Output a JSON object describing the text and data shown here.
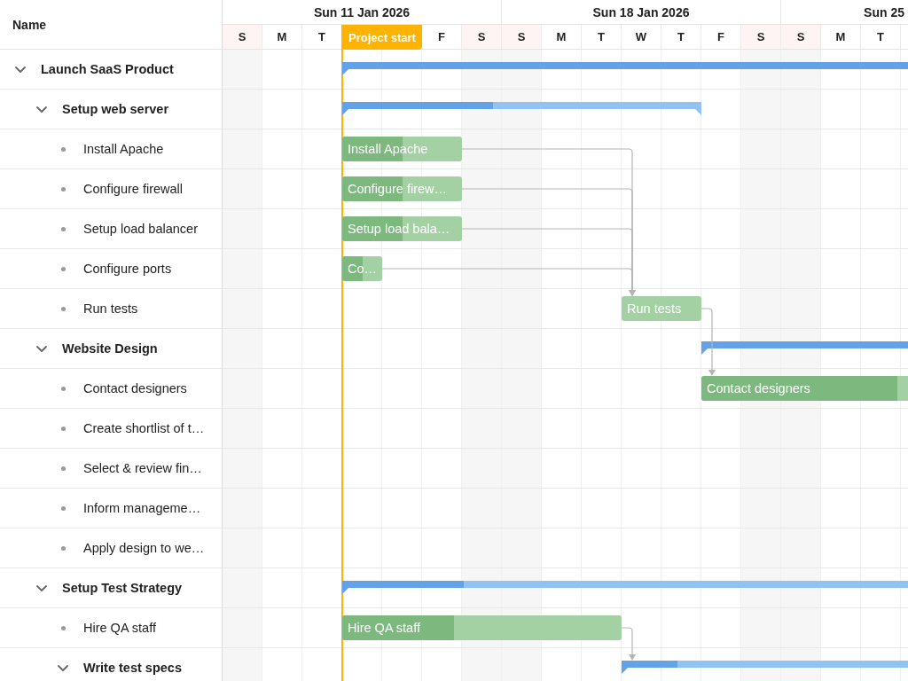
{
  "header": {
    "name_column": "Name"
  },
  "timeline": {
    "weeks": [
      "Sun 11 Jan 2026",
      "Sun 18 Jan 2026",
      "Sun 25"
    ],
    "days": [
      {
        "kind": "day",
        "letter": "S",
        "weekend": true
      },
      {
        "kind": "day",
        "letter": "M",
        "weekend": false
      },
      {
        "kind": "day",
        "letter": "T",
        "weekend": false
      },
      {
        "kind": "marker",
        "label": "Project start"
      },
      {
        "kind": "day",
        "letter": "F",
        "weekend": false
      },
      {
        "kind": "day",
        "letter": "S",
        "weekend": true
      },
      {
        "kind": "day",
        "letter": "S",
        "weekend": true
      },
      {
        "kind": "day",
        "letter": "M",
        "weekend": false
      },
      {
        "kind": "day",
        "letter": "T",
        "weekend": false
      },
      {
        "kind": "day",
        "letter": "W",
        "weekend": false
      },
      {
        "kind": "day",
        "letter": "T",
        "weekend": false
      },
      {
        "kind": "day",
        "letter": "F",
        "weekend": false
      },
      {
        "kind": "day",
        "letter": "S",
        "weekend": true
      },
      {
        "kind": "day",
        "letter": "S",
        "weekend": true
      },
      {
        "kind": "day",
        "letter": "M",
        "weekend": false
      },
      {
        "kind": "day",
        "letter": "T",
        "weekend": false
      }
    ]
  },
  "tasks": [
    {
      "name": "Launch SaaS Product",
      "kind": "summary",
      "expanded": true,
      "level": 1,
      "children": [
        {
          "name": "Setup web server",
          "kind": "summary",
          "expanded": true,
          "level": 0.42,
          "children": [
            {
              "name": "Install Apache",
              "kind": "task",
              "label": "Install Apache",
              "level": 0.5
            },
            {
              "name": "Configure firewall",
              "kind": "task",
              "label": "Configure firew…",
              "level": 0.5
            },
            {
              "name": "Setup load balancer",
              "kind": "task",
              "label": "Setup load bala…",
              "level": 0.5
            },
            {
              "name": "Configure ports",
              "kind": "task",
              "label": "Co…",
              "level": 0.5
            },
            {
              "name": "Run tests",
              "kind": "task",
              "label": "Run tests",
              "level": 0
            }
          ]
        },
        {
          "name": "Website Design",
          "kind": "summary",
          "expanded": true,
          "level": 1,
          "children": [
            {
              "name": "Contact designers",
              "kind": "task",
              "label": "Contact designers",
              "level": 0.82
            },
            {
              "name": "Create shortlist of t…",
              "kind": "task"
            },
            {
              "name": "Select & review fin…",
              "kind": "task"
            },
            {
              "name": "Inform manageme…",
              "kind": "task"
            },
            {
              "name": "Apply design to we…",
              "kind": "task"
            }
          ]
        },
        {
          "name": "Setup Test Strategy",
          "kind": "summary",
          "expanded": true,
          "level": 0.145,
          "children": [
            {
              "name": "Hire QA staff",
              "kind": "task",
              "label": "Hire QA staff",
              "level": 0.4
            },
            {
              "name": "Write test specs",
              "kind": "summary",
              "expanded": true,
              "level": 0.1
            }
          ]
        }
      ]
    }
  ]
}
